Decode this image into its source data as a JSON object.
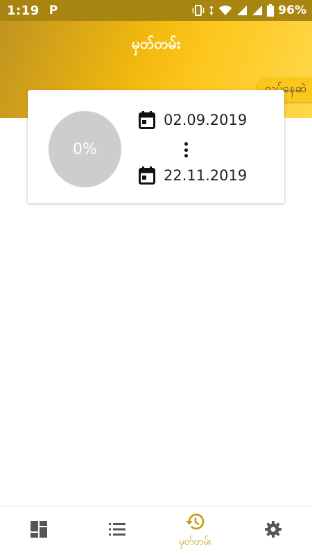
{
  "status_bar": {
    "time": "1:19",
    "notification_app": "P",
    "battery_percent": "96%",
    "icons": [
      "vibrate-icon",
      "data-arrows-icon",
      "wifi-icon",
      "signal-icon",
      "signal-icon",
      "battery-icon"
    ]
  },
  "header": {
    "title": "မှတ်တမ်း",
    "status_pill": "လုပ်နေဆဲ"
  },
  "card": {
    "progress": "0%",
    "start_date": "02.09.2019",
    "end_date": "22.11.2019"
  },
  "bottom_nav": {
    "items": [
      {
        "icon": "dashboard-icon",
        "label": "",
        "active": false
      },
      {
        "icon": "list-icon",
        "label": "",
        "active": false
      },
      {
        "icon": "history-icon",
        "label": "မှတ်တမ်း",
        "active": true
      },
      {
        "icon": "settings-icon",
        "label": "",
        "active": false
      }
    ]
  },
  "colors": {
    "accent": "#fbc71a",
    "status_bar": "#a88410",
    "active_nav": "#c49a0c",
    "progress_circle": "#cdcdcd"
  }
}
